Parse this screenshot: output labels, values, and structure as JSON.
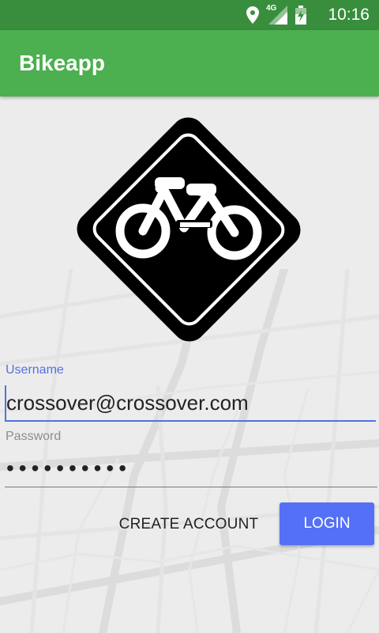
{
  "status_bar": {
    "time": "10:16",
    "network": "4G",
    "icons": [
      "location-icon",
      "signal-icon",
      "battery-icon"
    ]
  },
  "app_bar": {
    "title": "Bikeapp"
  },
  "logo": {
    "icon": "bicycle-sign-icon"
  },
  "form": {
    "username_label": "Username",
    "username_value": "crossover@crossover.com",
    "password_label": "Password",
    "password_value": "••••••••••"
  },
  "actions": {
    "create_account_label": "CREATE ACCOUNT",
    "login_label": "LOGIN"
  },
  "colors": {
    "status_bar": "#388e3c",
    "app_bar": "#4caf50",
    "accent": "#5470f7",
    "focused_label": "#5470e0"
  }
}
